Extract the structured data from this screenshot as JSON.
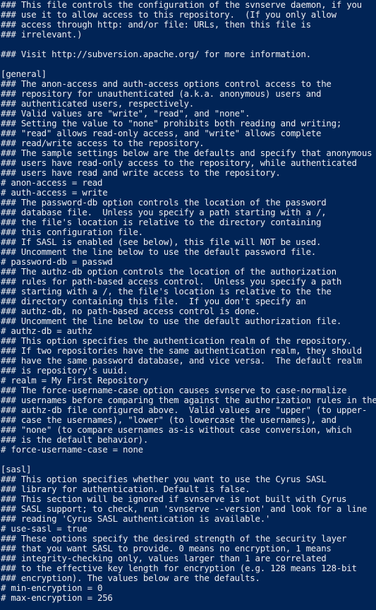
{
  "terminal": {
    "background": "#012456",
    "foreground": "#eeedf0",
    "lines": [
      "### This file controls the configuration of the svnserve daemon, if you",
      "### use it to allow access to this repository.  (If you only allow",
      "### access through http: and/or file: URLs, then this file is",
      "### irrelevant.)",
      "",
      "### Visit http://subversion.apache.org/ for more information.",
      "",
      "[general]",
      "### The anon-access and auth-access options control access to the",
      "### repository for unauthenticated (a.k.a. anonymous) users and",
      "### authenticated users, respectively.",
      "### Valid values are \"write\", \"read\", and \"none\".",
      "### Setting the value to \"none\" prohibits both reading and writing;",
      "### \"read\" allows read-only access, and \"write\" allows complete",
      "### read/write access to the repository.",
      "### The sample settings below are the defaults and specify that anonymous",
      "### users have read-only access to the repository, while authenticated",
      "### users have read and write access to the repository.",
      "# anon-access = read",
      "# auth-access = write",
      "### The password-db option controls the location of the password",
      "### database file.  Unless you specify a path starting with a /,",
      "### the file's location is relative to the directory containing",
      "### this configuration file.",
      "### If SASL is enabled (see below), this file will NOT be used.",
      "### Uncomment the line below to use the default password file.",
      "# password-db = passwd",
      "### The authz-db option controls the location of the authorization",
      "### rules for path-based access control.  Unless you specify a path",
      "### starting with a /, the file's location is relative to the the",
      "### directory containing this file.  If you don't specify an",
      "### authz-db, no path-based access control is done.",
      "### Uncomment the line below to use the default authorization file.",
      "# authz-db = authz",
      "### This option specifies the authentication realm of the repository.",
      "### If two repositories have the same authentication realm, they should",
      "### have the same password database, and vice versa.  The default realm",
      "### is repository's uuid.",
      "# realm = My First Repository",
      "### The force-username-case option causes svnserve to case-normalize",
      "### usernames before comparing them against the authorization rules in the",
      "### authz-db file configured above.  Valid values are \"upper\" (to upper-",
      "### case the usernames), \"lower\" (to lowercase the usernames), and",
      "### \"none\" (to compare usernames as-is without case conversion, which",
      "### is the default behavior).",
      "# force-username-case = none",
      "",
      "[sasl]",
      "### This option specifies whether you want to use the Cyrus SASL",
      "### library for authentication. Default is false.",
      "### This section will be ignored if svnserve is not built with Cyrus",
      "### SASL support; to check, run 'svnserve --version' and look for a line",
      "### reading 'Cyrus SASL authentication is available.'",
      "# use-sasl = true",
      "### These options specify the desired strength of the security layer",
      "### that you want SASL to provide. 0 means no encryption, 1 means",
      "### integrity-checking only, values larger than 1 are correlated",
      "### to the effective key length for encryption (e.g. 128 means 128-bit",
      "### encryption). The values below are the defaults.",
      "# min-encryption = 0",
      "# max-encryption = 256"
    ]
  }
}
